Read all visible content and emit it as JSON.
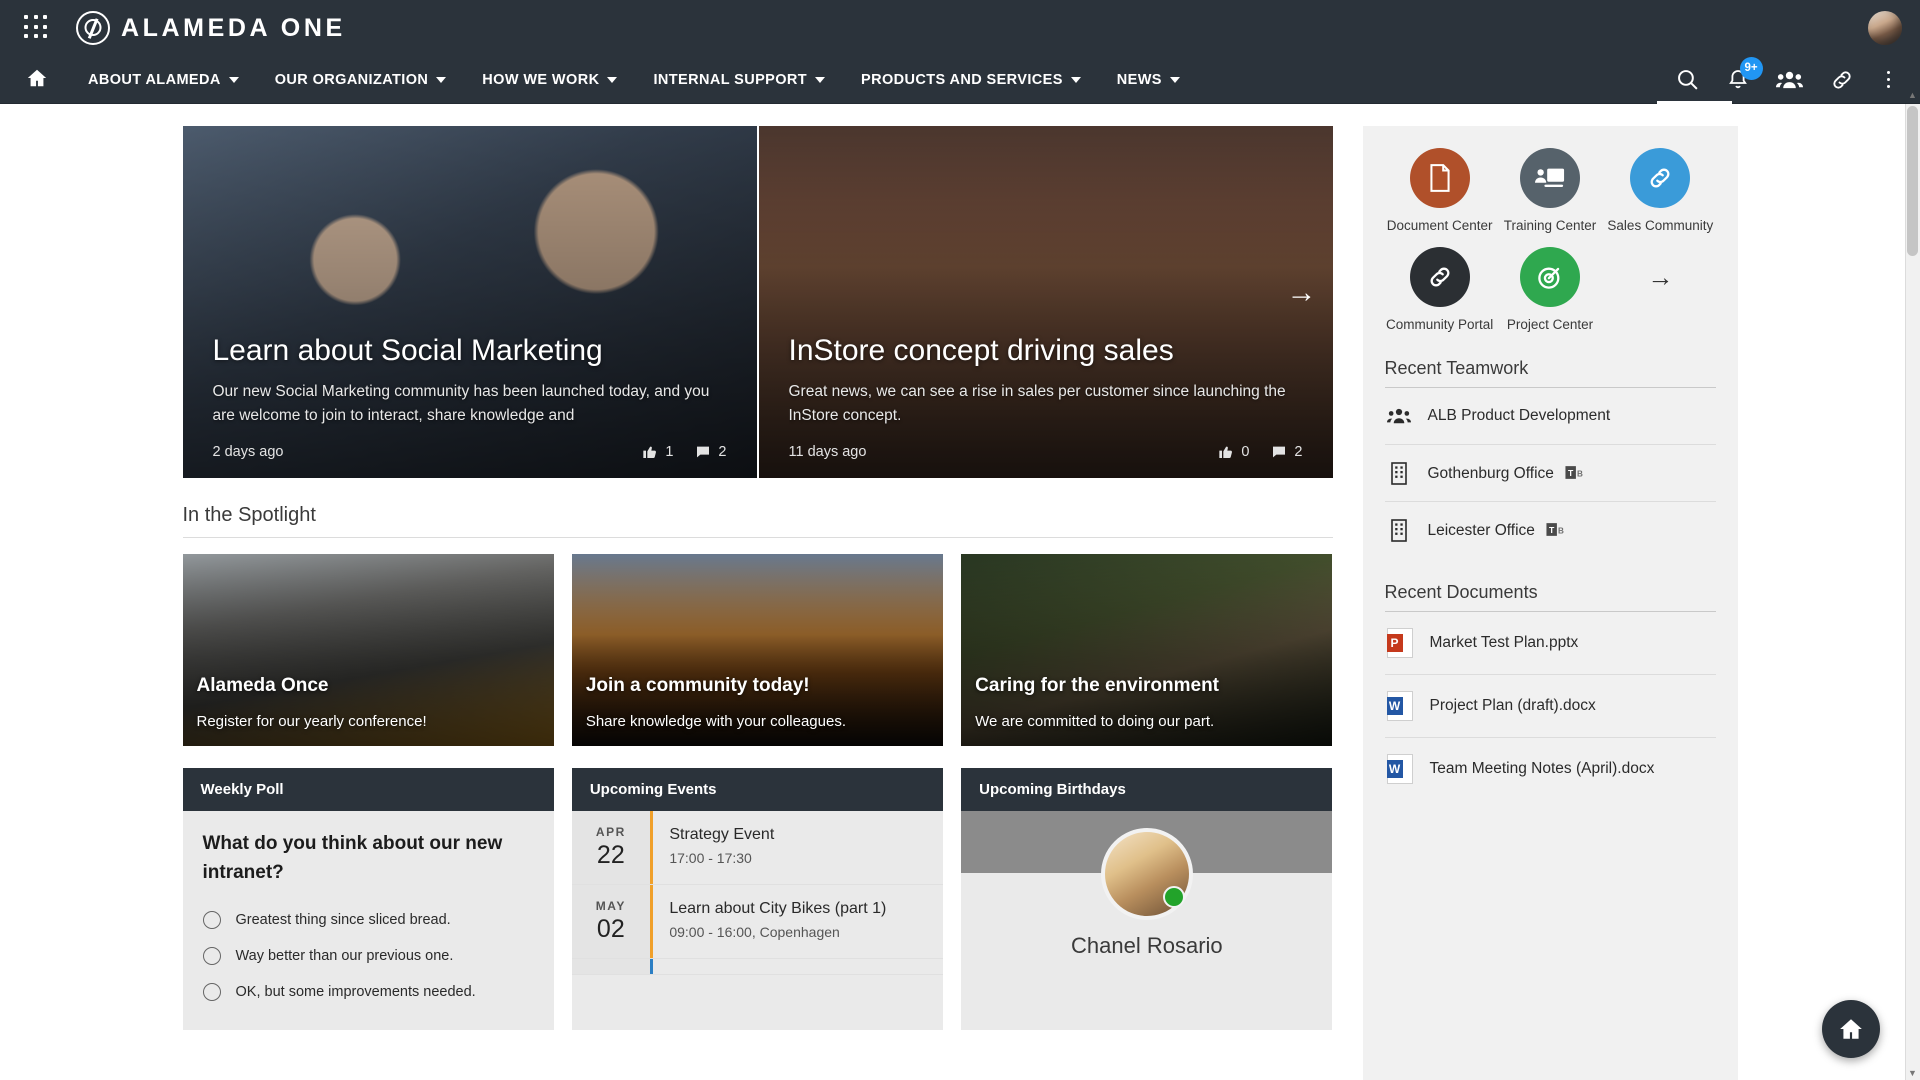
{
  "topbar": {
    "waffle_icon": "app-grid-icon",
    "brand_name": "ALAMEDA ONE",
    "avatar_icon": "user-avatar"
  },
  "nav": {
    "home_icon": "home-icon",
    "items": [
      {
        "label": "ABOUT ALAMEDA",
        "has_caret": true
      },
      {
        "label": "OUR ORGANIZATION",
        "has_caret": true
      },
      {
        "label": "HOW WE WORK",
        "has_caret": true
      },
      {
        "label": "INTERNAL SUPPORT",
        "has_caret": true
      },
      {
        "label": "PRODUCTS AND SERVICES",
        "has_caret": true
      },
      {
        "label": "NEWS",
        "has_caret": true
      }
    ],
    "search_icon": "search-icon",
    "bell_icon": "bell-icon",
    "notification_count": "9+",
    "people_icon": "people-icon",
    "link_icon": "link-icon",
    "more_icon": "kebab-menu-icon",
    "badge_color": "#2196f3"
  },
  "hero": {
    "next_arrow": "→",
    "cards": [
      {
        "title": "Learn about Social Marketing",
        "desc": "Our new Social Marketing community has been launched today, and you are welcome to join to interact, share knowledge and",
        "time": "2 days ago",
        "likes": "1",
        "comments": "2",
        "like_icon": "thumbs-up-icon",
        "comment_icon": "comment-icon"
      },
      {
        "title": "InStore concept driving sales",
        "desc": "Great news, we can see a rise in sales per customer since launching the InStore concept.",
        "time": "11 days ago",
        "likes": "0",
        "comments": "2",
        "like_icon": "thumbs-up-icon",
        "comment_icon": "comment-icon"
      }
    ]
  },
  "spotlight": {
    "heading": "In the Spotlight",
    "cards": [
      {
        "title": "Alameda Once",
        "sub": "Register for our yearly conference!"
      },
      {
        "title": "Join a community today!",
        "sub": "Share knowledge with your colleagues."
      },
      {
        "title": "Caring for the environment",
        "sub": "We are committed to doing our part."
      }
    ]
  },
  "poll": {
    "heading": "Weekly Poll",
    "question": "What do you think about our new intranet?",
    "options": [
      "Greatest thing since sliced bread.",
      "Way better than our previous one.",
      "OK, but some improvements needed."
    ]
  },
  "events": {
    "heading": "Upcoming Events",
    "items": [
      {
        "month": "APR",
        "day": "22",
        "title": "Strategy Event",
        "time": "17:00 - 17:30",
        "accent": "#f0a02a"
      },
      {
        "month": "MAY",
        "day": "02",
        "title": "Learn about City Bikes (part 1)",
        "time": "09:00 - 16:00, Copenhagen",
        "accent": "#f0a02a"
      },
      {
        "month": "",
        "day": "",
        "title": "",
        "time": "",
        "accent": "#2c7fc4"
      }
    ]
  },
  "birthdays": {
    "heading": "Upcoming Birthdays",
    "person_name": "Chanel Rosario",
    "status_color": "#22a32a"
  },
  "sidebar": {
    "quick_links": [
      {
        "label": "Document Center",
        "icon": "document-icon",
        "color": "#b0502a"
      },
      {
        "label": "Training Center",
        "icon": "training-icon",
        "color": "#56626b"
      },
      {
        "label": "Sales Community",
        "icon": "link-icon",
        "color": "#3a9bd9"
      },
      {
        "label": "Community Portal",
        "icon": "link-icon",
        "color": "#2b2f33"
      },
      {
        "label": "Project Center",
        "icon": "target-icon",
        "color": "#2fa84f"
      }
    ],
    "quick_links_more": "→",
    "teamwork_heading": "Recent Teamwork",
    "teamwork": [
      {
        "label": "ALB Product Development",
        "icon": "people-icon",
        "teams_badge": false
      },
      {
        "label": "Gothenburg Office",
        "icon": "building-icon",
        "teams_badge": true
      },
      {
        "label": "Leicester Office",
        "icon": "building-icon",
        "teams_badge": true
      }
    ],
    "documents_heading": "Recent Documents",
    "documents": [
      {
        "label": "Market Test Plan.pptx",
        "icon": "powerpoint-icon",
        "tag": "P",
        "color": "#c5391c"
      },
      {
        "label": "Project Plan (draft).docx",
        "icon": "word-icon",
        "tag": "W",
        "color": "#2357a4"
      },
      {
        "label": "Team Meeting Notes (April).docx",
        "icon": "word-icon",
        "tag": "W",
        "color": "#2357a4"
      }
    ]
  },
  "fab": {
    "icon": "home-icon",
    "glyph": "⌂"
  }
}
